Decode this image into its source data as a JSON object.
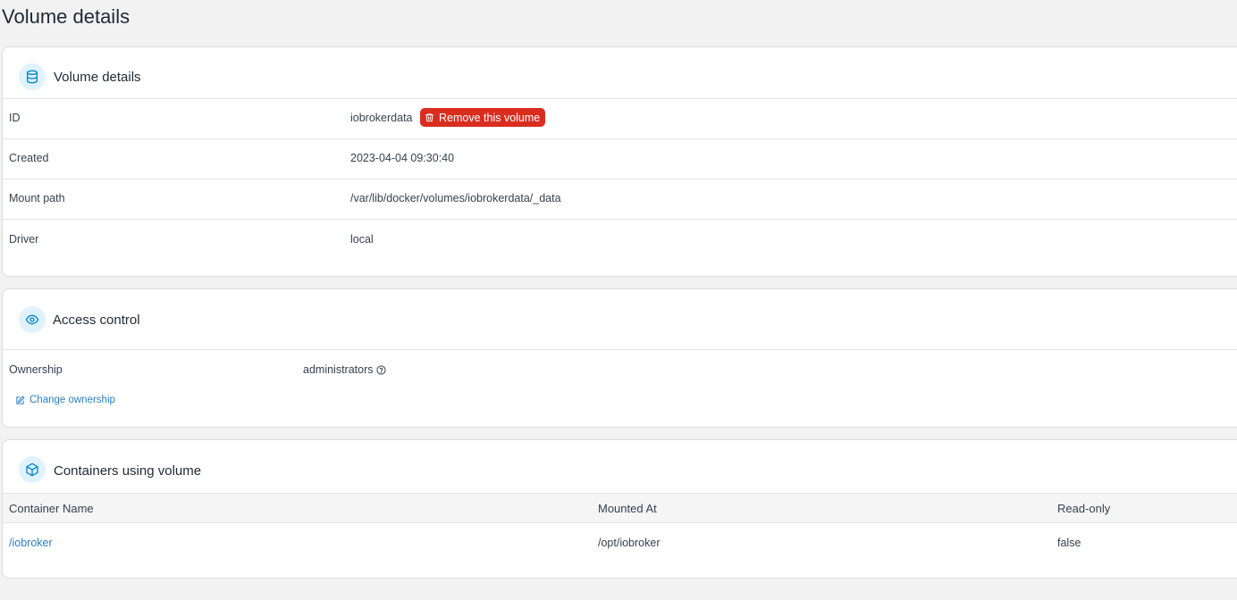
{
  "page": {
    "title": "Volume details"
  },
  "details_card": {
    "title": "Volume details",
    "icon": "database-icon",
    "rows": [
      {
        "label": "ID",
        "value": "iobrokerdata"
      },
      {
        "label": "Created",
        "value": "2023-04-04 09:30:40"
      },
      {
        "label": "Mount path",
        "value": "/var/lib/docker/volumes/iobrokerdata/_data"
      },
      {
        "label": "Driver",
        "value": "local"
      }
    ],
    "remove_button": "Remove this volume"
  },
  "access_card": {
    "title": "Access control",
    "icon": "eye-icon",
    "ownership_label": "Ownership",
    "ownership_value": "administrators",
    "change_link": "Change ownership"
  },
  "containers_card": {
    "title": "Containers using volume",
    "icon": "box-icon",
    "columns": [
      "Container Name",
      "Mounted At",
      "Read-only"
    ],
    "rows": [
      {
        "name": "/iobroker",
        "mounted_at": "/opt/iobroker",
        "read_only": "false"
      }
    ]
  },
  "colors": {
    "accent": "#0086c9",
    "danger": "#d92d20",
    "link": "#2b7fc2"
  }
}
